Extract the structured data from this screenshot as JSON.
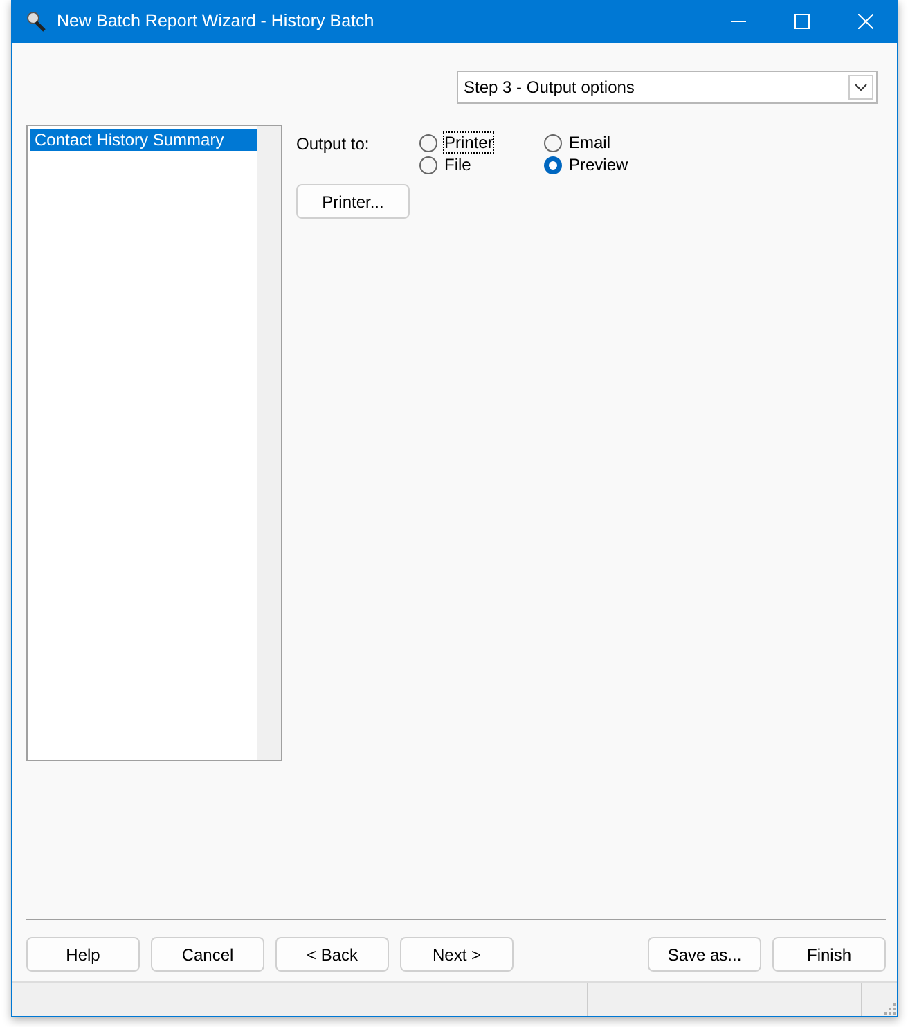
{
  "window": {
    "title": "New Batch Report Wizard - History Batch"
  },
  "step_dropdown": {
    "value": "Step 3 - Output options"
  },
  "report_list": {
    "items": [
      {
        "label": "Contact History Summary",
        "selected": true
      }
    ]
  },
  "output": {
    "label": "Output to:",
    "options": [
      {
        "label": "Printer",
        "selected": false,
        "focused": true
      },
      {
        "label": "Email",
        "selected": false,
        "focused": false
      },
      {
        "label": "File",
        "selected": false,
        "focused": false
      },
      {
        "label": "Preview",
        "selected": true,
        "focused": false
      }
    ]
  },
  "printer_button": "Printer...",
  "buttons_left": [
    "Help",
    "Cancel",
    "< Back",
    "Next >"
  ],
  "buttons_right": [
    "Save as...",
    "Finish"
  ]
}
